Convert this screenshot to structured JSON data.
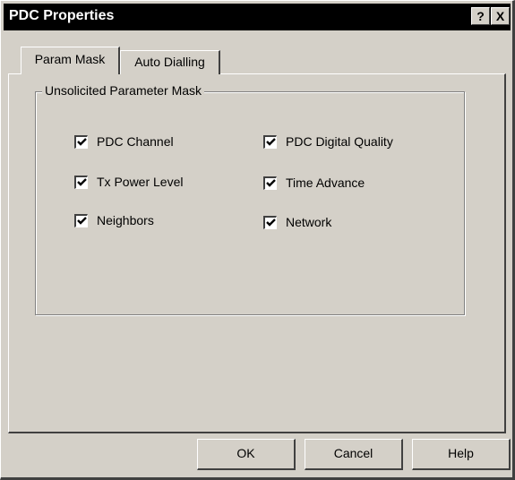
{
  "window": {
    "title": "PDC Properties",
    "help_button": "?",
    "close_button": "X"
  },
  "tabs": [
    {
      "label": "Param Mask",
      "active": true
    },
    {
      "label": "Auto Dialling",
      "active": false
    }
  ],
  "group": {
    "title": "Unsolicited Parameter Mask",
    "checkboxes": [
      {
        "label": "PDC Channel",
        "checked": true
      },
      {
        "label": "Tx Power Level",
        "checked": true
      },
      {
        "label": "Neighbors",
        "checked": true
      },
      {
        "label": "PDC Digital Quality",
        "checked": true
      },
      {
        "label": "Time Advance",
        "checked": true
      },
      {
        "label": "Network",
        "checked": true
      }
    ]
  },
  "buttons": {
    "ok": "OK",
    "cancel": "Cancel",
    "help": "Help"
  },
  "colors": {
    "face": "#d4d0c8",
    "titlebar": "#000000",
    "shadow": "#404040",
    "highlight": "#ffffff"
  }
}
